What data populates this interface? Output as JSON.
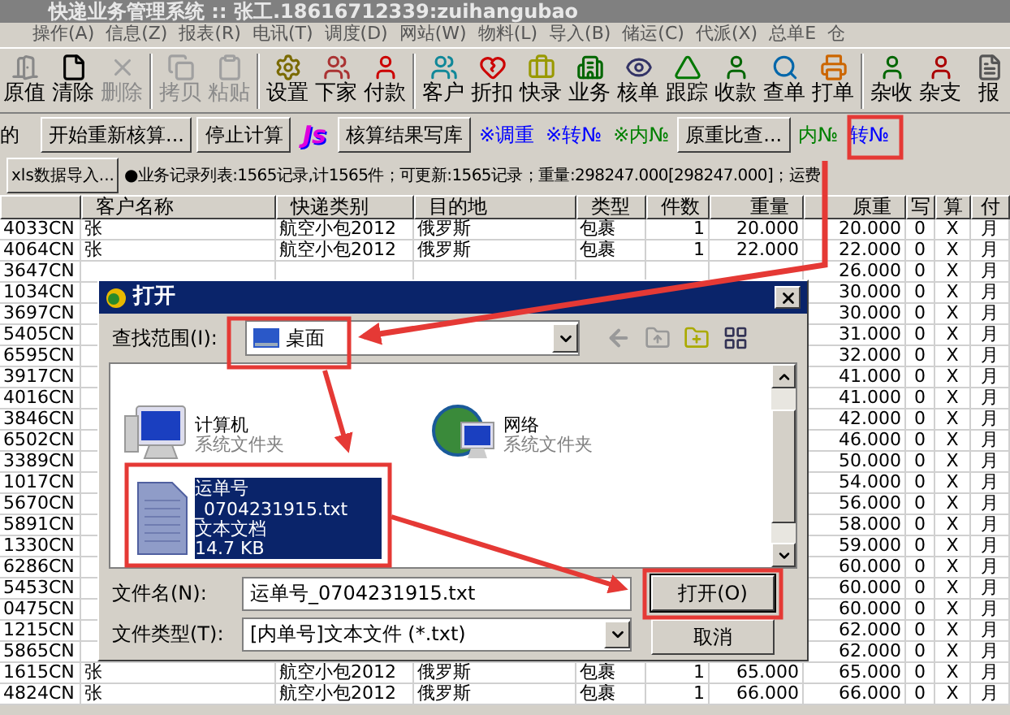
{
  "window": {
    "title": "快递业务管理系统 :: 张工.18616712339:zuihangubao"
  },
  "menu": [
    "操作(A)",
    "信息(Z)",
    "报表(R)",
    "电讯(T)",
    "调度(D)",
    "网站(W)",
    "物料(L)",
    "导入(B)",
    "储运(C)",
    "代派(X)",
    "总单E",
    "仓"
  ],
  "toolbar": [
    [
      {
        "label": "原值",
        "disabled": false
      },
      {
        "label": "清除",
        "disabled": false
      },
      {
        "label": "删除",
        "disabled": true
      }
    ],
    [
      {
        "label": "拷贝",
        "disabled": true
      },
      {
        "label": "粘贴",
        "disabled": true
      }
    ],
    [
      {
        "label": "设置",
        "disabled": false
      },
      {
        "label": "下家",
        "disabled": false
      },
      {
        "label": "付款",
        "disabled": false
      }
    ],
    [
      {
        "label": "客户",
        "disabled": false
      },
      {
        "label": "折扣",
        "disabled": false
      },
      {
        "label": "快录",
        "disabled": false
      },
      {
        "label": "业务",
        "disabled": false
      },
      {
        "label": "核单",
        "disabled": false
      },
      {
        "label": "跟踪",
        "disabled": false
      },
      {
        "label": "收款",
        "disabled": false
      },
      {
        "label": "查单",
        "disabled": false
      },
      {
        "label": "打单",
        "disabled": false
      }
    ],
    [
      {
        "label": "杂收",
        "disabled": false
      },
      {
        "label": "杂支",
        "disabled": false
      },
      {
        "label": "报",
        "disabled": false
      }
    ]
  ],
  "calc_bar": {
    "label": "的",
    "items": [
      {
        "kind": "button",
        "label": "开始重新核算..."
      },
      {
        "kind": "button",
        "label": "停止计算"
      },
      {
        "kind": "logo",
        "label": "Js"
      },
      {
        "kind": "button",
        "label": "核算结果写库"
      },
      {
        "kind": "link",
        "label": "※调重",
        "color": "#0000ff"
      },
      {
        "kind": "link",
        "label": "※转№",
        "color": "#0000ff"
      },
      {
        "kind": "link",
        "label": "※内№",
        "color": "#008000"
      },
      {
        "kind": "button",
        "label": "原重比查..."
      },
      {
        "kind": "link",
        "label": "内№",
        "color": "#008000"
      },
      {
        "kind": "link",
        "label": "转№",
        "color": "#0000ff"
      }
    ]
  },
  "import_button": "xls数据导入...",
  "status_text": "●业务记录列表:1565记录,计1565件；可更新:1565记录；重量:298247.000[298247.000]；运费",
  "table": {
    "columns": [
      "",
      "客户名称",
      "快递类别",
      "目的地",
      "类型",
      "件数",
      "重量",
      "原重",
      "写",
      "算",
      "付"
    ],
    "rows": [
      {
        "id": "4033CN",
        "customer": "张",
        "category": "航空小包2012",
        "destination": "俄罗斯",
        "type": "包裹",
        "count": "1",
        "weight": "20.000",
        "orig_weight": "20.000",
        "written": "0",
        "calc": "X",
        "payment": "月"
      },
      {
        "id": "4064CN",
        "customer": "张",
        "category": "航空小包2012",
        "destination": "俄罗斯",
        "type": "包裹",
        "count": "1",
        "weight": "22.000",
        "orig_weight": "22.000",
        "written": "0",
        "calc": "X",
        "payment": "月"
      },
      {
        "id": "3647CN",
        "orig_weight": "26.000",
        "written": "0",
        "calc": "X",
        "payment": "月"
      },
      {
        "id": "1034CN",
        "orig_weight": "30.000",
        "written": "0",
        "calc": "X",
        "payment": "月"
      },
      {
        "id": "3697CN",
        "orig_weight": "30.000",
        "written": "0",
        "calc": "X",
        "payment": "月"
      },
      {
        "id": "5405CN",
        "orig_weight": "31.000",
        "written": "0",
        "calc": "X",
        "payment": "月"
      },
      {
        "id": "6595CN",
        "orig_weight": "32.000",
        "written": "0",
        "calc": "X",
        "payment": "月"
      },
      {
        "id": "3917CN",
        "orig_weight": "41.000",
        "written": "0",
        "calc": "X",
        "payment": "月"
      },
      {
        "id": "4016CN",
        "orig_weight": "41.000",
        "written": "0",
        "calc": "X",
        "payment": "月"
      },
      {
        "id": "3846CN",
        "orig_weight": "42.000",
        "written": "0",
        "calc": "X",
        "payment": "月"
      },
      {
        "id": "6502CN",
        "orig_weight": "46.000",
        "written": "0",
        "calc": "X",
        "payment": "月"
      },
      {
        "id": "3389CN",
        "orig_weight": "50.000",
        "written": "0",
        "calc": "X",
        "payment": "月"
      },
      {
        "id": "1017CN",
        "orig_weight": "54.000",
        "written": "0",
        "calc": "X",
        "payment": "月"
      },
      {
        "id": "5670CN",
        "orig_weight": "56.000",
        "written": "0",
        "calc": "X",
        "payment": "月"
      },
      {
        "id": "5891CN",
        "orig_weight": "58.000",
        "written": "0",
        "calc": "X",
        "payment": "月"
      },
      {
        "id": "1330CN",
        "orig_weight": "59.000",
        "written": "0",
        "calc": "X",
        "payment": "月"
      },
      {
        "id": "6286CN",
        "orig_weight": "60.000",
        "written": "0",
        "calc": "X",
        "payment": "月"
      },
      {
        "id": "5453CN",
        "orig_weight": "60.000",
        "written": "0",
        "calc": "X",
        "payment": "月"
      },
      {
        "id": "0475CN",
        "orig_weight": "60.000",
        "written": "0",
        "calc": "X",
        "payment": "月"
      },
      {
        "id": "1215CN",
        "orig_weight": "62.000",
        "written": "0",
        "calc": "X",
        "payment": "月"
      },
      {
        "id": "5865CN",
        "orig_weight": "62.000",
        "written": "0",
        "calc": "X",
        "payment": "月"
      },
      {
        "id": "1615CN",
        "customer": "张",
        "category": "航空小包2012",
        "destination": "俄罗斯",
        "type": "包裹",
        "count": "1",
        "weight": "65.000",
        "orig_weight": "65.000",
        "written": "0",
        "calc": "X",
        "payment": "月"
      },
      {
        "id": "4824CN",
        "customer": "张",
        "category": "航空小包2012",
        "destination": "俄罗斯",
        "type": "包裹",
        "count": "1",
        "weight": "66.000",
        "orig_weight": "66.000",
        "written": "0",
        "calc": "X",
        "payment": "月"
      }
    ]
  },
  "dialog": {
    "title": "打开",
    "look_in_label": "查找范围(I):",
    "look_in": "桌面",
    "items": [
      {
        "kind": "computer",
        "name": "计算机",
        "description": "系统文件夹",
        "selected": false
      },
      {
        "kind": "network",
        "name": "网络",
        "description": "系统文件夹",
        "selected": false
      },
      {
        "kind": "file",
        "name": "运单号_0704231915.txt",
        "description": "文本文档",
        "size": "14.7 KB",
        "selected": true
      }
    ],
    "filename_label": "文件名(N):",
    "filename": "运单号_0704231915.txt",
    "filetype_label": "文件类型(T):",
    "filetype": "[内单号]文本文件 (*.txt)",
    "open_button": "打开(O)",
    "cancel_button": "取消"
  }
}
